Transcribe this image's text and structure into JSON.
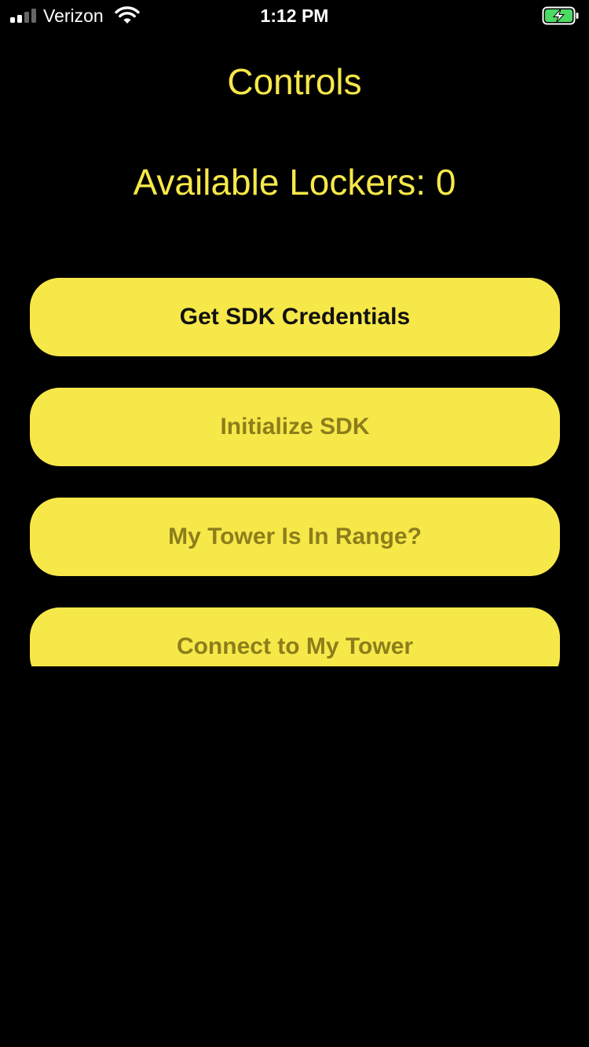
{
  "status_bar": {
    "carrier": "Verizon",
    "time": "1:12 PM",
    "signal_bars": 2,
    "signal_total": 4,
    "icons": [
      "signal-icon",
      "wifi-icon",
      "battery-charging-icon"
    ],
    "battery_color": "#4CD964"
  },
  "screen": {
    "title": "Controls",
    "available_lockers": "Available Lockers: 0"
  },
  "buttons": [
    {
      "label": "Get SDK Credentials",
      "enabled": true
    },
    {
      "label": "Initialize SDK",
      "enabled": false
    },
    {
      "label": "My Tower Is In Range?",
      "enabled": false
    },
    {
      "label": "Connect to My Tower",
      "enabled": false
    }
  ],
  "colors": {
    "background": "#000000",
    "accent_yellow": "#F7E849",
    "enabled_text": "#111111",
    "disabled_text": "#8C7E1B"
  }
}
